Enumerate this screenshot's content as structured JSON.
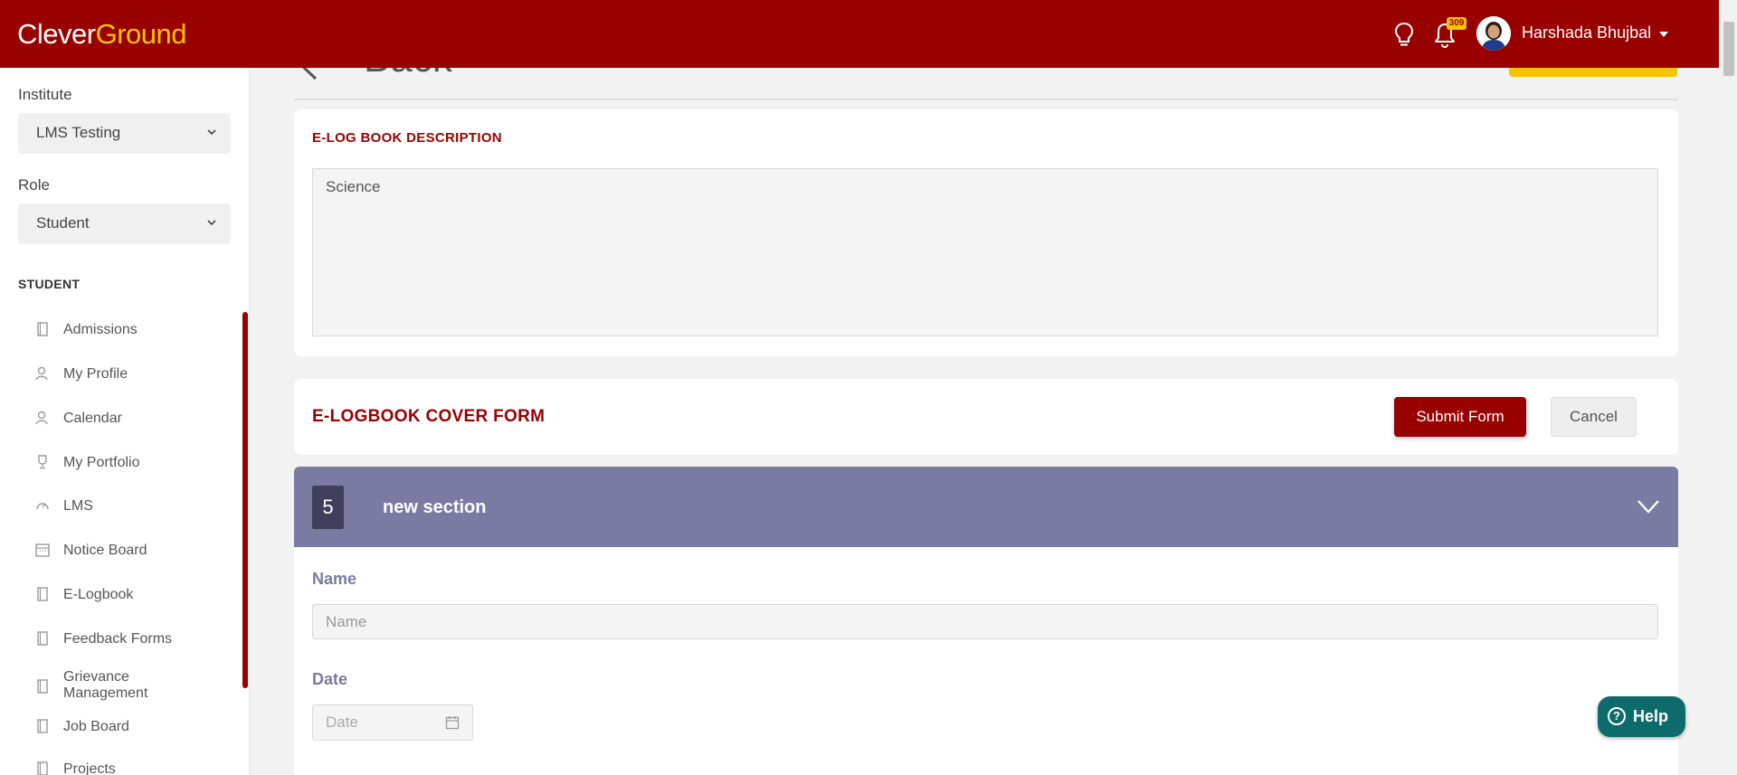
{
  "header": {
    "logo_part1": "Clever",
    "logo_part2": "Ground",
    "notification_count": "309",
    "user_name": "Harshada Bhujbal",
    "icons": [
      "lightbulb-icon",
      "bell-icon",
      "avatar",
      "caret-down-icon"
    ]
  },
  "sidebar": {
    "institute_label": "Institute",
    "institute_value": "LMS Testing",
    "role_label": "Role",
    "role_value": "Student",
    "section_title": "STUDENT",
    "items": [
      {
        "label": "Admissions",
        "icon": "book-icon"
      },
      {
        "label": "My Profile",
        "icon": "user-icon"
      },
      {
        "label": "Calendar",
        "icon": "user-icon"
      },
      {
        "label": "My Portfolio",
        "icon": "trophy-icon"
      },
      {
        "label": "LMS",
        "icon": "gauge-icon"
      },
      {
        "label": "Notice Board",
        "icon": "calendar-icon"
      },
      {
        "label": "E-Logbook",
        "icon": "book-icon"
      },
      {
        "label": "Feedback Forms",
        "icon": "book-icon"
      },
      {
        "label": "Grievance Management",
        "icon": "book-icon"
      },
      {
        "label": "Job Board",
        "icon": "book-icon"
      },
      {
        "label": "Projects",
        "icon": "book-icon"
      }
    ]
  },
  "main": {
    "back_label": "Back",
    "description_title": "E-LOG BOOK DESCRIPTION",
    "description_value": "Science",
    "form_title": "E-LOGBOOK COVER FORM",
    "submit_label": "Submit Form",
    "cancel_label": "Cancel",
    "section_number": "5",
    "section_title": "new section",
    "name_label": "Name",
    "name_placeholder": "Name",
    "date_label": "Date",
    "date_placeholder": "Date"
  },
  "help": {
    "label": "Help"
  },
  "colors": {
    "brand": "#990000",
    "accent": "#f5c400",
    "section_bar": "#7a7aa3",
    "help_button": "#0e6b6b"
  }
}
